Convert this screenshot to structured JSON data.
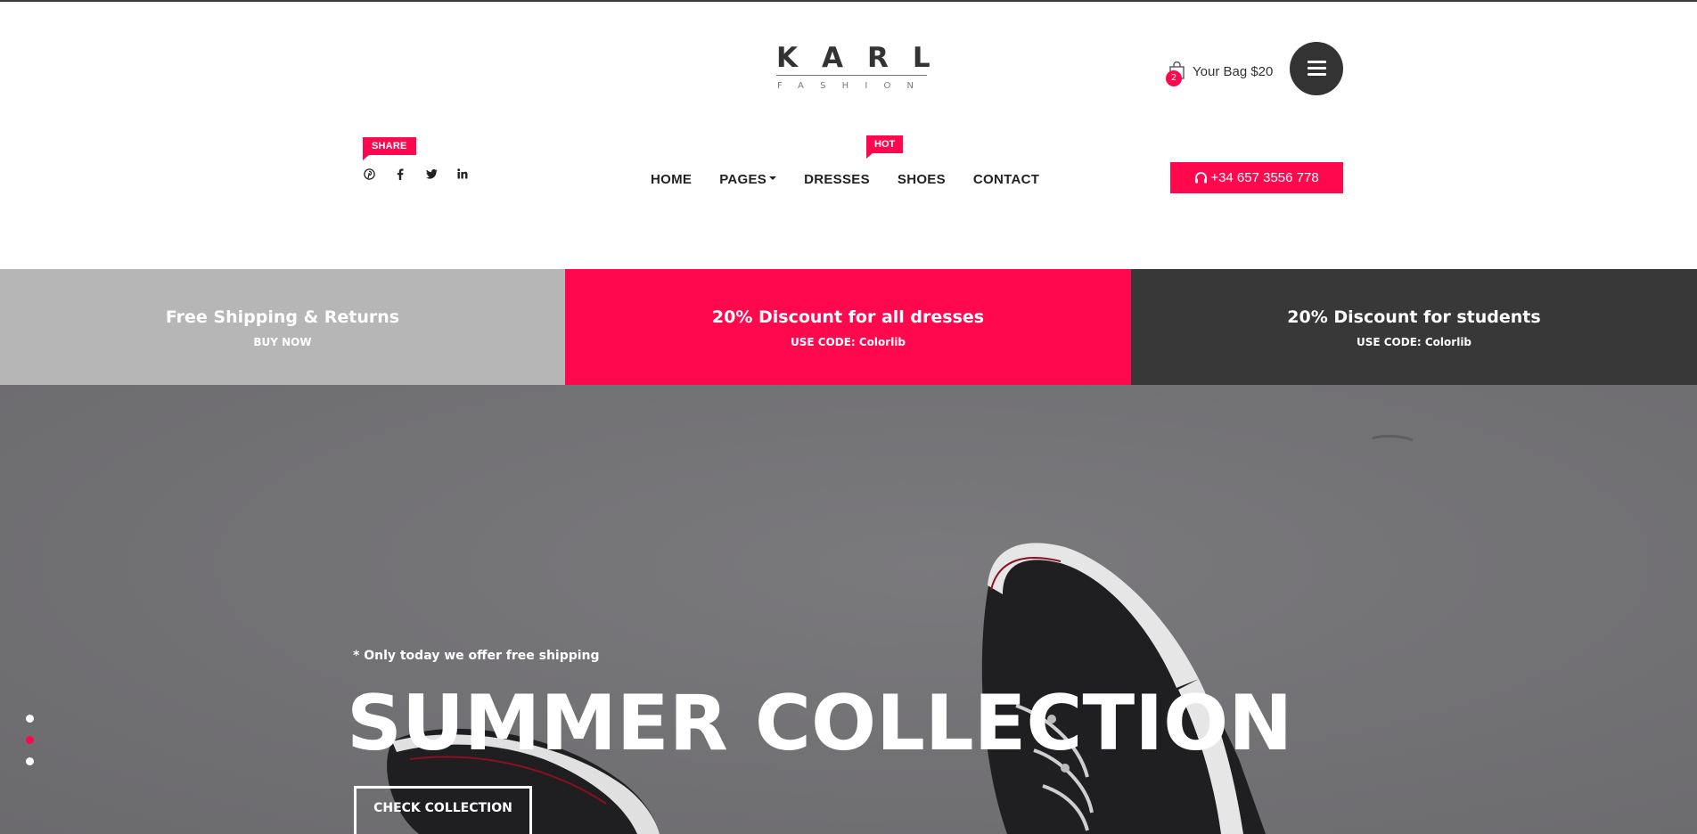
{
  "brand": {
    "logo_main": "KARL",
    "logo_sub": "FASHION"
  },
  "cart": {
    "count": "2",
    "label": "Your Bag $20"
  },
  "social": {
    "share_label": "SHARE",
    "icons": [
      "pinterest-icon",
      "facebook-icon",
      "twitter-icon",
      "linkedin-icon"
    ]
  },
  "nav": {
    "items": [
      "HOME",
      "PAGES",
      "DRESSES",
      "SHOES",
      "CONTACT"
    ],
    "hot_label": "HOT"
  },
  "phone": {
    "number": "+34 657 3556 778"
  },
  "promos": [
    {
      "title": "Free Shipping & Returns",
      "subtitle": "BUY NOW"
    },
    {
      "title": "20% Discount for all dresses",
      "subtitle": "USE CODE: Colorlib"
    },
    {
      "title": "20% Discount for students",
      "subtitle": "USE CODE: Colorlib"
    }
  ],
  "hero": {
    "note": "* Only today we offer free shipping",
    "title": "SUMMER COLLECTION",
    "button": "CHECK COLLECTION",
    "slides": 3,
    "active_slide": 2
  },
  "colors": {
    "accent": "#ff084e",
    "dark": "#333333",
    "promo_grey": "#b6b6b6",
    "promo_dark": "#383838"
  }
}
